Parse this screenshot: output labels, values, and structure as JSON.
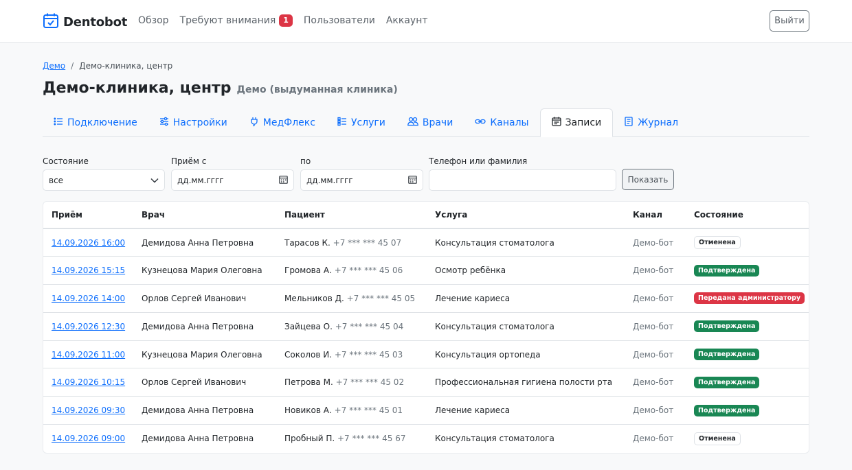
{
  "brand": {
    "name": "Dentobot",
    "logo_icon": "calendar-check-icon"
  },
  "nav": {
    "overview": "Обзор",
    "attention": "Требуют внимания",
    "attention_count": "1",
    "users": "Пользователи",
    "account": "Аккаунт",
    "logout": "Выйти"
  },
  "breadcrumb": {
    "root": "Демо",
    "sep": "/",
    "current": "Демо-клиника, центр"
  },
  "page": {
    "title": "Демо-клиника, центр",
    "subtitle": "Демо (выдуманная клиника)"
  },
  "tabs": [
    {
      "label": "Подключение",
      "icon": "list-icon"
    },
    {
      "label": "Настройки",
      "icon": "sliders-icon"
    },
    {
      "label": "МедФлекс",
      "icon": "plug-icon"
    },
    {
      "label": "Услуги",
      "icon": "list-check-icon"
    },
    {
      "label": "Врачи",
      "icon": "people-icon"
    },
    {
      "label": "Каналы",
      "icon": "link-icon"
    },
    {
      "label": "Записи",
      "icon": "calendar-icon",
      "active": true
    },
    {
      "label": "Журнал",
      "icon": "journal-icon"
    }
  ],
  "filters": {
    "state_label": "Состояние",
    "state_value": "все",
    "from_label": "Приём с",
    "from_placeholder": "дд.мм.гггг",
    "to_label": "по",
    "to_placeholder": "дд.мм.гггг",
    "search_label": "Телефон или фамилия",
    "search_value": "",
    "show_button": "Показать"
  },
  "table": {
    "headers": [
      "Приём",
      "Врач",
      "Пациент",
      "Услуга",
      "Канал",
      "Состояние"
    ],
    "rows": [
      {
        "time": "14.09.2026 16:00",
        "doctor": "Демидова Анна Петровна",
        "patient": "Тарасов К.",
        "phone": "+7 *** *** 45 07",
        "service": "Консультация стоматолога",
        "channel": "Демо-бот",
        "status": "Отменена",
        "status_kind": "light"
      },
      {
        "time": "14.09.2026 15:15",
        "doctor": "Кузнецова Мария Олеговна",
        "patient": "Громова А.",
        "phone": "+7 *** *** 45 06",
        "service": "Осмотр ребёнка",
        "channel": "Демо-бот",
        "status": "Подтверждена",
        "status_kind": "green"
      },
      {
        "time": "14.09.2026 14:00",
        "doctor": "Орлов Сергей Иванович",
        "patient": "Мельников Д.",
        "phone": "+7 *** *** 45 05",
        "service": "Лечение кариеса",
        "channel": "Демо-бот",
        "status": "Передана администратору",
        "status_kind": "red"
      },
      {
        "time": "14.09.2026 12:30",
        "doctor": "Демидова Анна Петровна",
        "patient": "Зайцева О.",
        "phone": "+7 *** *** 45 04",
        "service": "Консультация стоматолога",
        "channel": "Демо-бот",
        "status": "Подтверждена",
        "status_kind": "green"
      },
      {
        "time": "14.09.2026 11:00",
        "doctor": "Кузнецова Мария Олеговна",
        "patient": "Соколов И.",
        "phone": "+7 *** *** 45 03",
        "service": "Консультация ортопеда",
        "channel": "Демо-бот",
        "status": "Подтверждена",
        "status_kind": "green"
      },
      {
        "time": "14.09.2026 10:15",
        "doctor": "Орлов Сергей Иванович",
        "patient": "Петрова М.",
        "phone": "+7 *** *** 45 02",
        "service": "Профессиональная гигиена полости рта",
        "channel": "Демо-бот",
        "status": "Подтверждена",
        "status_kind": "green"
      },
      {
        "time": "14.09.2026 09:30",
        "doctor": "Демидова Анна Петровна",
        "patient": "Новиков А.",
        "phone": "+7 *** *** 45 01",
        "service": "Лечение кариеса",
        "channel": "Демо-бот",
        "status": "Подтверждена",
        "status_kind": "green"
      },
      {
        "time": "14.09.2026 09:00",
        "doctor": "Демидова Анна Петровна",
        "patient": "Пробный П.",
        "phone": "+7 *** *** 45 67",
        "service": "Консультация стоматолога",
        "channel": "Демо-бот",
        "status": "Отменена",
        "status_kind": "light"
      }
    ]
  },
  "colors": {
    "primary": "#0d6efd",
    "success": "#198754",
    "danger": "#dc3545",
    "muted": "#6c757d"
  }
}
